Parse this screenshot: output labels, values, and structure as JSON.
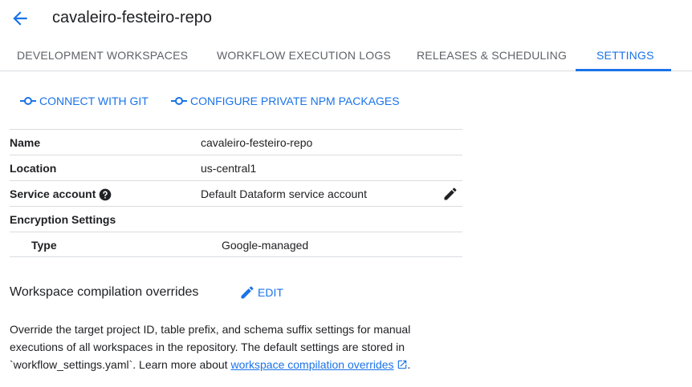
{
  "header": {
    "title": "cavaleiro-festeiro-repo",
    "back_icon": "arrow-back-icon"
  },
  "tabs": [
    {
      "label": "DEVELOPMENT WORKSPACES",
      "active": false
    },
    {
      "label": "WORKFLOW EXECUTION LOGS",
      "active": false
    },
    {
      "label": "RELEASES & SCHEDULING",
      "active": false
    },
    {
      "label": "SETTINGS",
      "active": true
    }
  ],
  "actions": {
    "connect_git": "CONNECT WITH GIT",
    "configure_npm": "CONFIGURE PRIVATE NPM PACKAGES"
  },
  "details": {
    "name": {
      "label": "Name",
      "value": "cavaleiro-festeiro-repo"
    },
    "location": {
      "label": "Location",
      "value": "us-central1"
    },
    "service_account": {
      "label": "Service account",
      "value": "Default Dataform service account"
    },
    "encryption": {
      "label": "Encryption Settings"
    },
    "type": {
      "label": "Type",
      "value": "Google-managed"
    }
  },
  "overrides": {
    "title": "Workspace compilation overrides",
    "edit_label": "EDIT",
    "description_prefix": "Override the target project ID, table prefix, and schema suffix settings for manual executions of all workspaces in the repository. The default settings are stored in `workflow_settings.yaml`. Learn more about ",
    "link_text": "workspace compilation overrides",
    "description_suffix": "."
  },
  "colors": {
    "accent": "#1a73e8",
    "text": "#202124",
    "muted": "#5f6368",
    "divider": "#dadce0"
  }
}
